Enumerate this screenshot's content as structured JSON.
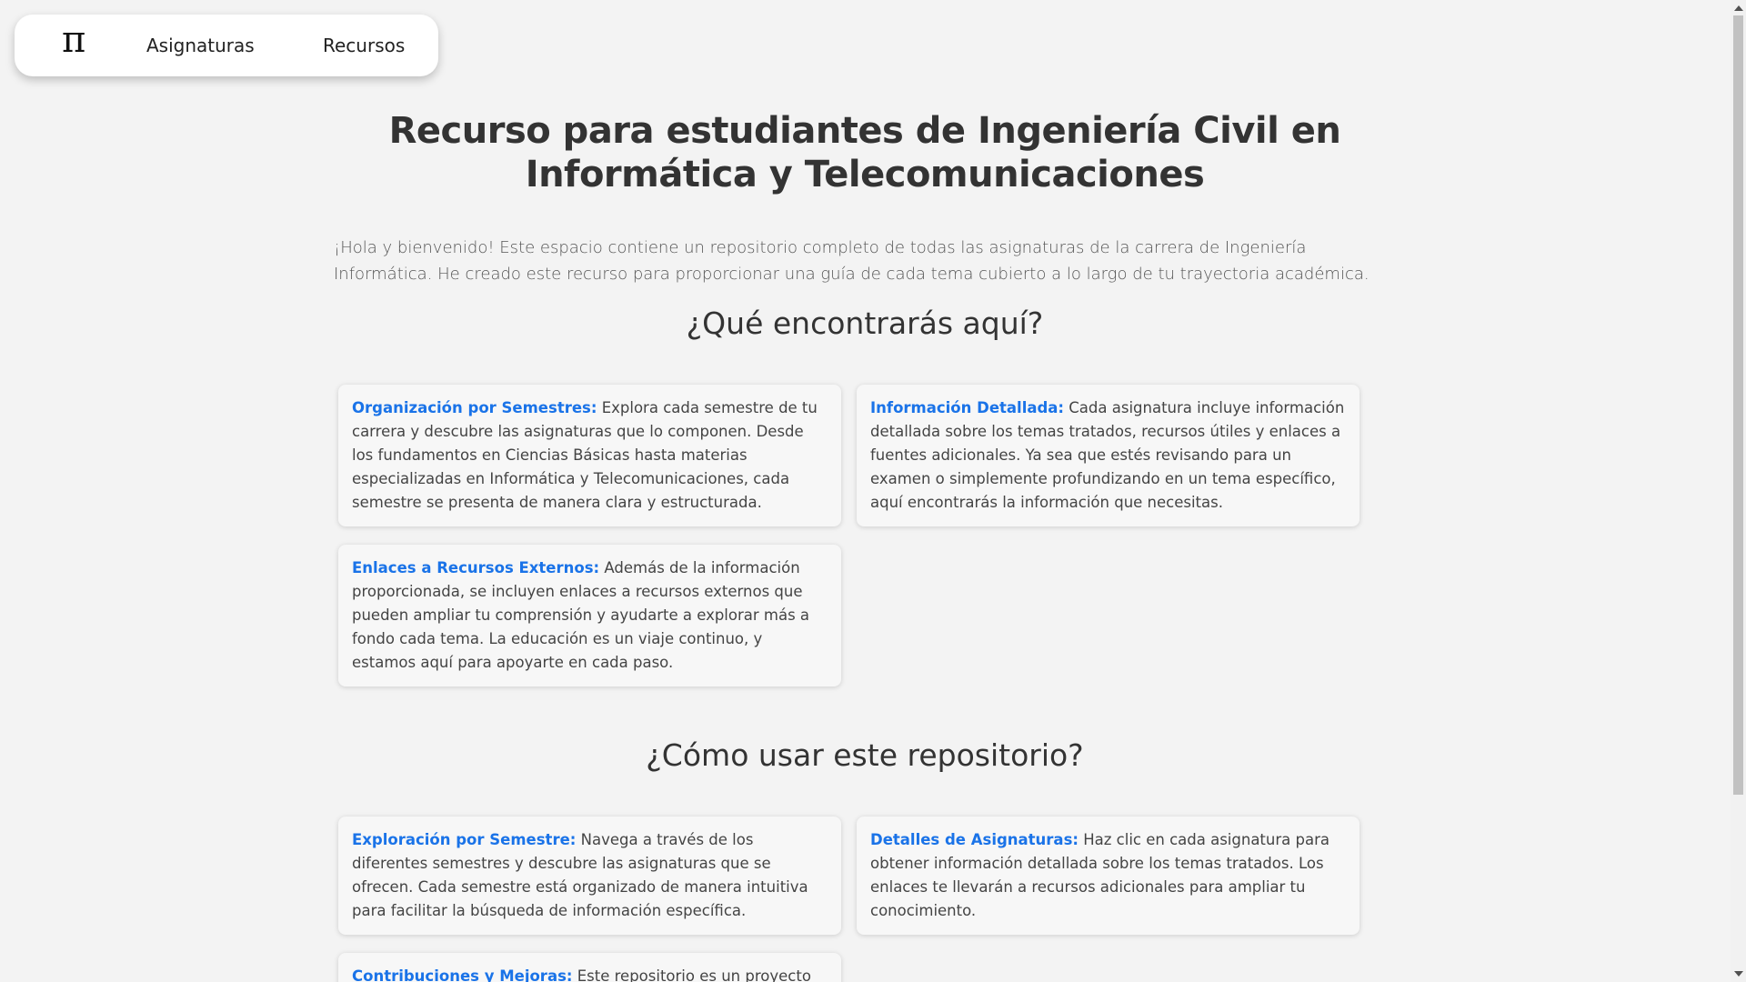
{
  "nav": {
    "logo": "π",
    "links": [
      {
        "label": "Asignaturas"
      },
      {
        "label": "Recursos"
      }
    ]
  },
  "main": {
    "title": "Recurso para estudiantes de Ingeniería Civil en Informática y Telecomunicaciones",
    "intro": "¡Hola y bienvenido! Este espacio contiene un repositorio completo de todas las asignaturas de la carrera de Ingeniería Informática. He creado este recurso para proporcionar una guía de cada tema cubierto a lo largo de tu trayectoria académica.",
    "section_what": {
      "heading": "¿Qué encontrarás aquí?",
      "cards": [
        {
          "title": "Organización por Semestres:",
          "text": " Explora cada semestre de tu carrera y descubre las asignaturas que lo componen. Desde los fundamentos en Ciencias Básicas hasta materias especializadas en Informática y Telecomunicaciones, cada semestre se presenta de manera clara y estructurada."
        },
        {
          "title": "Información Detallada:",
          "text": " Cada asignatura incluye información detallada sobre los temas tratados, recursos útiles y enlaces a fuentes adicionales. Ya sea que estés revisando para un examen o simplemente profundizando en un tema específico, aquí encontrarás la información que necesitas."
        },
        {
          "title": "Enlaces a Recursos Externos:",
          "text": " Además de la información proporcionada, se incluyen enlaces a recursos externos que pueden ampliar tu comprensión y ayudarte a explorar más a fondo cada tema. La educación es un viaje continuo, y estamos aquí para apoyarte en cada paso."
        }
      ]
    },
    "section_how": {
      "heading": "¿Cómo usar este repositorio?",
      "cards": [
        {
          "title": "Exploración por Semestre:",
          "text": " Navega a través de los diferentes semestres y descubre las asignaturas que se ofrecen. Cada semestre está organizado de manera intuitiva para facilitar la búsqueda de información específica."
        },
        {
          "title": "Detalles de Asignaturas:",
          "text": " Haz clic en cada asignatura para obtener información detallada sobre los temas tratados. Los enlaces te llevarán a recursos adicionales para ampliar tu conocimiento."
        },
        {
          "title": "Contribuciones y Mejoras:",
          "text": " Este repositorio es un proyecto"
        }
      ]
    }
  },
  "colors": {
    "background": "#f3f3f3",
    "accent": "#1a73e8",
    "text": "#333333"
  }
}
